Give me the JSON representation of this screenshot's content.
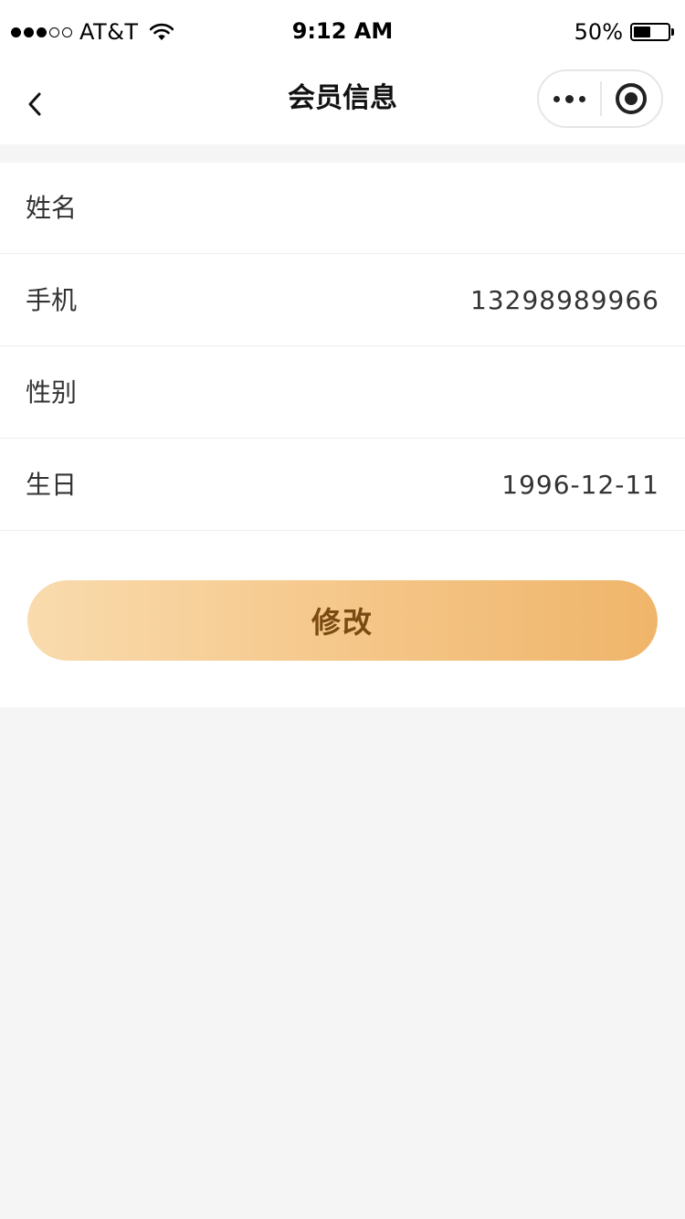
{
  "status_bar": {
    "carrier": "AT&T",
    "time": "9:12 AM",
    "battery": "50%",
    "battery_level": 0.5,
    "signal_bars_filled": 3,
    "signal_bars_total": 5
  },
  "nav": {
    "title": "会员信息",
    "back_icon": "chevron-left-icon",
    "more_icon": "more-dots-icon",
    "close_icon": "target-circle-icon"
  },
  "form": {
    "rows": [
      {
        "label": "姓名",
        "value": ""
      },
      {
        "label": "手机",
        "value": "13298989966"
      },
      {
        "label": "性别",
        "value": ""
      },
      {
        "label": "生日",
        "value": "1996-12-11"
      }
    ],
    "submit_label": "修改"
  },
  "colors": {
    "button_gradient_start": "#f9dbad",
    "button_gradient_end": "#efb56a",
    "button_text": "#7a4a13",
    "page_background": "#f5f5f5"
  }
}
